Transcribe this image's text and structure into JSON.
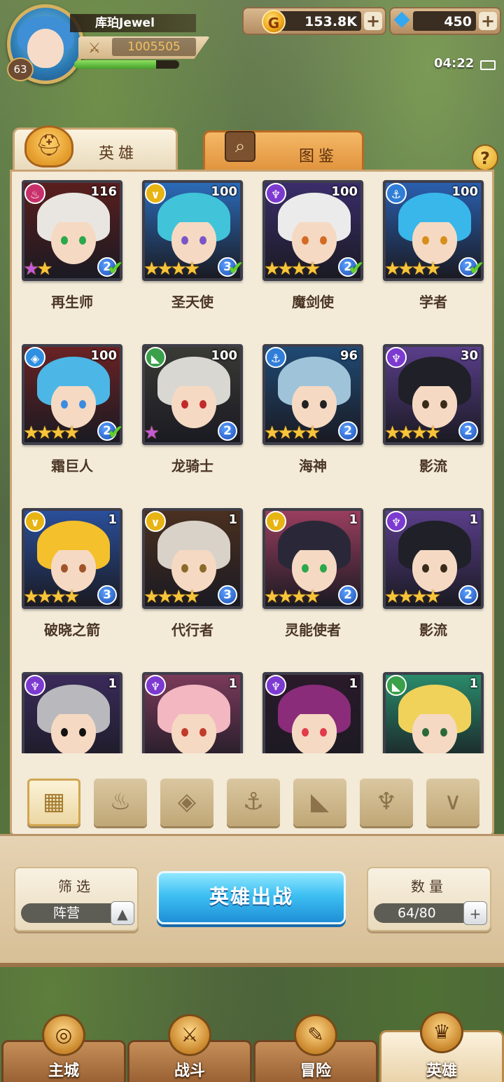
{
  "player": {
    "name": "库珀Jewel",
    "level": "63",
    "power": "1005505",
    "exp_fraction": 0.78
  },
  "resources": {
    "gold": "153.8K",
    "gems": "450",
    "plus": "+"
  },
  "status": {
    "time": "04:22"
  },
  "tabs": {
    "heroes": "英雄",
    "codex": "图鉴",
    "help": "?"
  },
  "heroes": [
    {
      "name": "再生师",
      "level": "116",
      "stars": "★★",
      "rank": "2",
      "faction": "flame",
      "faction_color": "#c8306a",
      "hair": "#e9e6e2",
      "bg": "#5a1e1e",
      "eye": "#2aa84a",
      "checked": true,
      "rainbow": true
    },
    {
      "name": "圣天使",
      "level": "100",
      "stars": "★★★★",
      "rank": "3",
      "faction": "light",
      "faction_color": "#e7b413",
      "hair": "#41c3d9",
      "bg": "#2b6bb8",
      "eye": "#7a55c8",
      "checked": true
    },
    {
      "name": "魔剑使",
      "level": "100",
      "stars": "★★★★",
      "rank": "2",
      "faction": "dark",
      "faction_color": "#7d3ad1",
      "hair": "#ecebeb",
      "bg": "#3a2d6a",
      "eye": "#d36b25",
      "checked": true
    },
    {
      "name": "学者",
      "level": "100",
      "stars": "★★★★",
      "rank": "2",
      "faction": "water",
      "faction_color": "#2f7ed8",
      "hair": "#39b6ea",
      "bg": "#2a5fae",
      "eye": "#d88e1c",
      "checked": true
    },
    {
      "name": "霜巨人",
      "level": "100",
      "stars": "★★★★",
      "rank": "2",
      "faction": "frost",
      "faction_color": "#2f8fe0",
      "hair": "#4cb7e6",
      "bg": "#6a2224",
      "eye": "#3d8be0",
      "checked": true
    },
    {
      "name": "龙骑士",
      "level": "100",
      "stars": "★",
      "rank": "2",
      "faction": "beast",
      "faction_color": "#3aa04a",
      "hair": "#d9d7d2",
      "bg": "#3a3a36",
      "eye": "#c22a2a",
      "checked": false,
      "rainbow": true
    },
    {
      "name": "海神",
      "level": "96",
      "stars": "★★★★",
      "rank": "2",
      "faction": "water",
      "faction_color": "#2f7ed8",
      "hair": "#9fc3d8",
      "bg": "#1f4a74",
      "eye": "#222222",
      "checked": false
    },
    {
      "name": "影流",
      "level": "30",
      "stars": "★★★★",
      "rank": "2",
      "faction": "dark",
      "faction_color": "#7d3ad1",
      "hair": "#202028",
      "bg": "#5a3e8a",
      "eye": "#3a2a1a",
      "checked": false
    },
    {
      "name": "破晓之箭",
      "level": "1",
      "stars": "★★★★",
      "rank": "3",
      "faction": "light",
      "faction_color": "#e7b413",
      "hair": "#f4c02c",
      "bg": "#2a4f9a",
      "eye": "#a0542a",
      "checked": false
    },
    {
      "name": "代行者",
      "level": "1",
      "stars": "★★★★",
      "rank": "3",
      "faction": "light",
      "faction_color": "#e7b413",
      "hair": "#d9d2c8",
      "bg": "#4a3020",
      "eye": "#8a6a2a",
      "checked": false
    },
    {
      "name": "灵能使者",
      "level": "1",
      "stars": "★★★★",
      "rank": "2",
      "faction": "light",
      "faction_color": "#e7b413",
      "hair": "#2a2838",
      "bg": "#9a3e5e",
      "eye": "#2aa84a",
      "checked": false
    },
    {
      "name": "影流",
      "level": "1",
      "stars": "★★★★",
      "rank": "2",
      "faction": "dark",
      "faction_color": "#7d3ad1",
      "hair": "#202028",
      "bg": "#5a3e8a",
      "eye": "#3a2a1a",
      "checked": false
    },
    {
      "name": "",
      "level": "1",
      "stars": "",
      "rank": "",
      "faction": "dark",
      "faction_color": "#7d3ad1",
      "hair": "#b9b9bd",
      "bg": "#3a2a5a",
      "eye": "#111111",
      "checked": false
    },
    {
      "name": "",
      "level": "1",
      "stars": "",
      "rank": "",
      "faction": "dark",
      "faction_color": "#7d3ad1",
      "hair": "#f3b7c2",
      "bg": "#7a3a5a",
      "eye": "#c23a2a",
      "checked": false
    },
    {
      "name": "",
      "level": "1",
      "stars": "",
      "rank": "",
      "faction": "dark",
      "faction_color": "#7d3ad1",
      "hair": "#8a2c7a",
      "bg": "#2a1a2a",
      "eye": "#e23a4a",
      "checked": false
    },
    {
      "name": "",
      "level": "1",
      "stars": "",
      "rank": "",
      "faction": "beast",
      "faction_color": "#3aa04a",
      "hair": "#f0d25a",
      "bg": "#2a8a6a",
      "eye": "#2a6a3a",
      "checked": false
    }
  ],
  "filters": [
    {
      "id": "all",
      "icon": "grid-icon",
      "glyph": "▦",
      "active": true
    },
    {
      "id": "flame",
      "icon": "flame-faction-icon",
      "glyph": "♨"
    },
    {
      "id": "frost",
      "icon": "frost-faction-icon",
      "glyph": "◈"
    },
    {
      "id": "water",
      "icon": "anchor-faction-icon",
      "glyph": "⚓"
    },
    {
      "id": "beast",
      "icon": "beast-faction-icon",
      "glyph": "◣"
    },
    {
      "id": "dark",
      "icon": "dark-faction-icon",
      "glyph": "♆"
    },
    {
      "id": "light",
      "icon": "light-faction-icon",
      "glyph": "∨"
    }
  ],
  "controls": {
    "filter_title": "筛选",
    "filter_value": "阵营",
    "deploy_label": "英雄出战",
    "count_title": "数量",
    "count_value": "64/80"
  },
  "nav": [
    {
      "label": "主城",
      "icon": "castle-icon",
      "glyph": "◎"
    },
    {
      "label": "战斗",
      "icon": "crossed-swords-icon",
      "glyph": "⚔"
    },
    {
      "label": "冒险",
      "icon": "map-scroll-icon",
      "glyph": "✎"
    },
    {
      "label": "英雄",
      "icon": "hero-crest-icon",
      "glyph": "♛",
      "active": true
    }
  ]
}
